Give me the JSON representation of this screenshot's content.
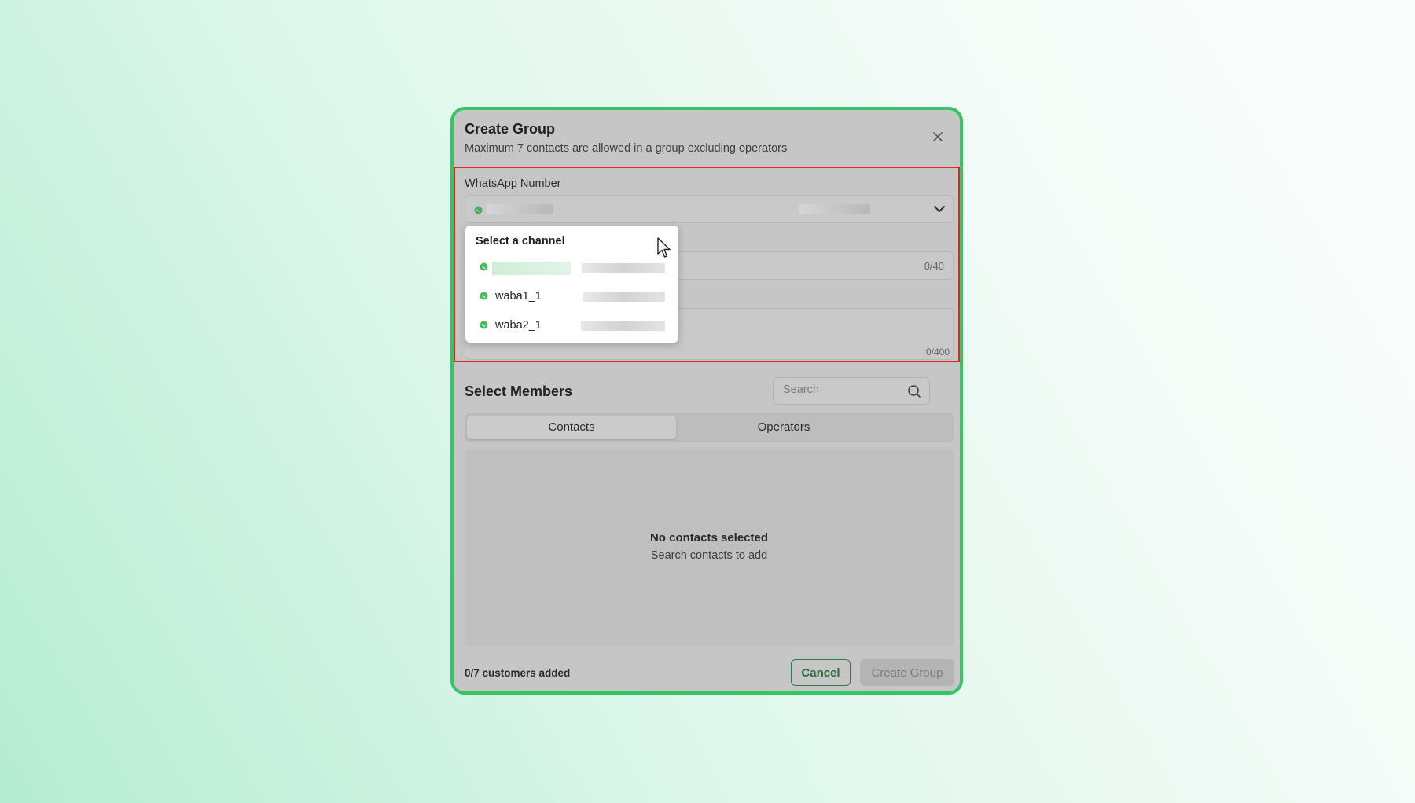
{
  "modal": {
    "title": "Create Group",
    "subtitle": "Maximum 7 contacts are allowed in a group excluding operators"
  },
  "form": {
    "whatsapp_label": "WhatsApp Number",
    "name_counter": "0/40",
    "description_counter": "0/400"
  },
  "dropdown": {
    "title": "Select a channel",
    "channels": [
      {
        "name": "",
        "icon": "whatsapp-icon"
      },
      {
        "name": "waba1_1",
        "icon": "whatsapp-icon"
      },
      {
        "name": "waba2_1",
        "icon": "whatsapp-icon"
      }
    ]
  },
  "members": {
    "title": "Select Members",
    "search_placeholder": "Search",
    "tabs": [
      "Contacts",
      "Operators"
    ],
    "active_tab": "Contacts",
    "empty_title": "No contacts selected",
    "empty_subtitle": "Search contacts to add"
  },
  "footer": {
    "added_count": "0/7 customers added",
    "cancel_label": "Cancel",
    "create_label": "Create Group"
  },
  "colors": {
    "accent_green": "#37c463",
    "highlight_red": "#d92828",
    "whatsapp_green": "#3fbf5a"
  }
}
